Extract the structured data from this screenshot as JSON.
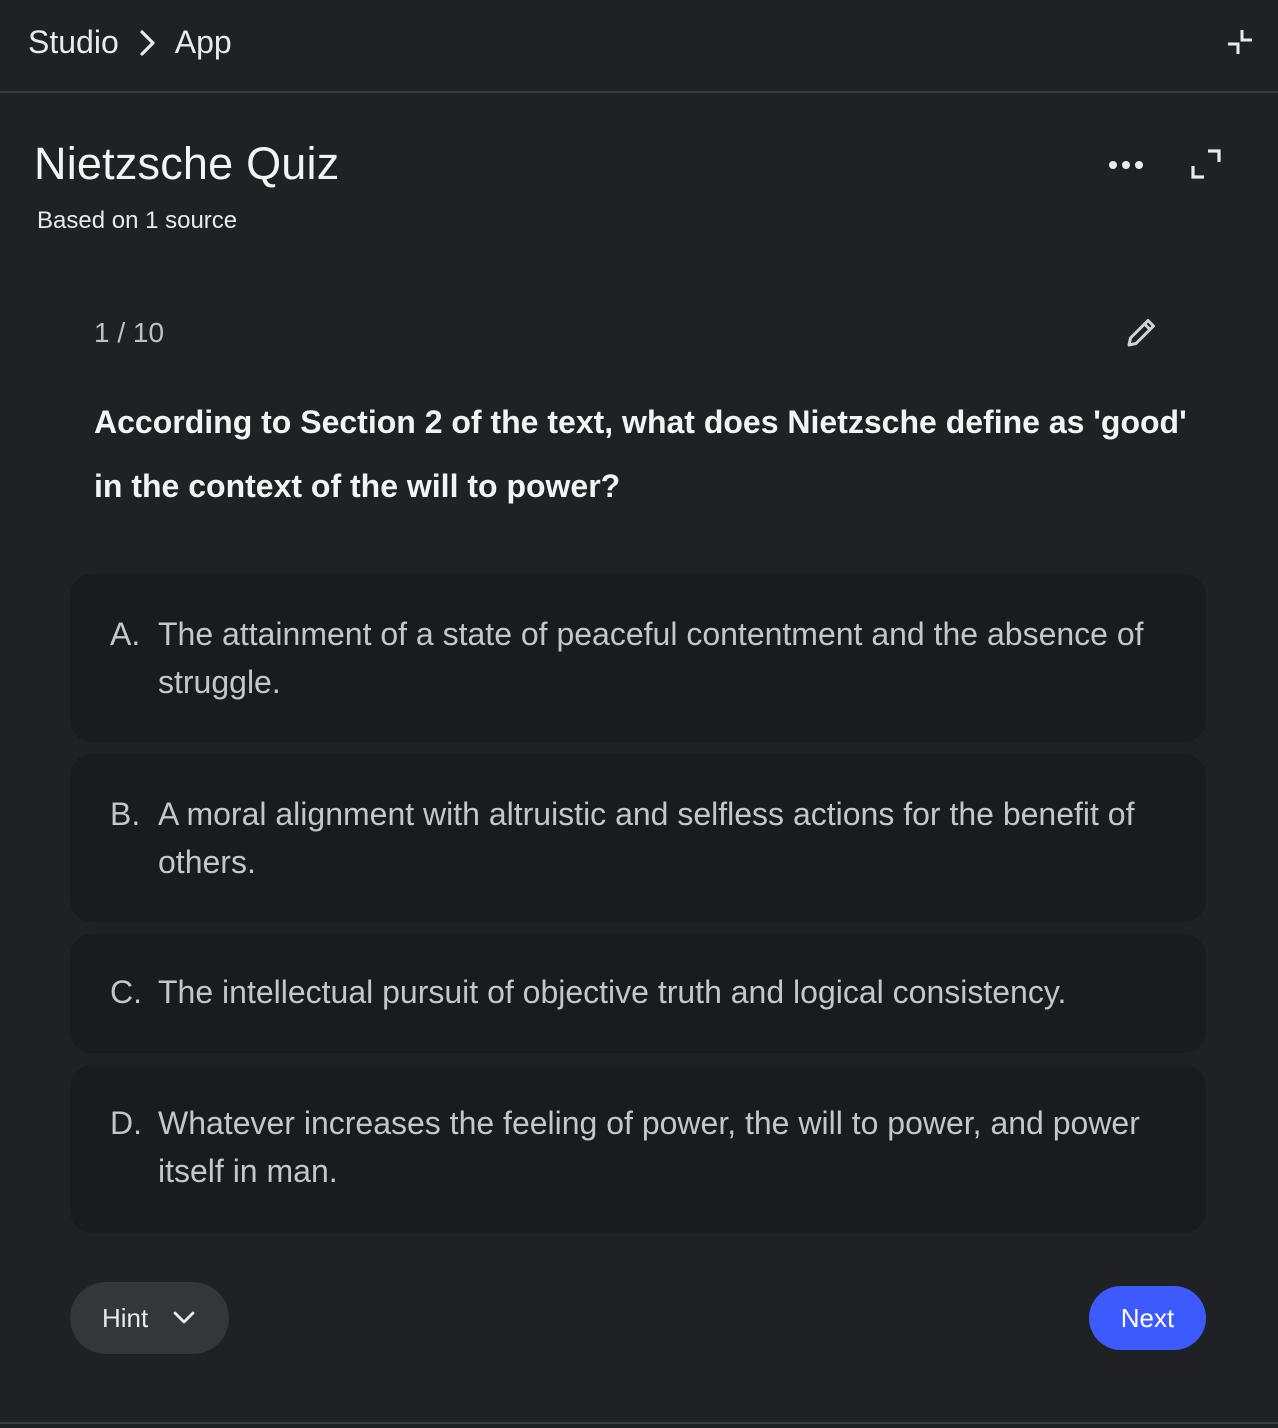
{
  "breadcrumb": {
    "root": "Studio",
    "current": "App"
  },
  "header": {
    "title": "Nietzsche Quiz",
    "subtitle": "Based on 1 source"
  },
  "quiz": {
    "counter": "1 / 10",
    "question": "According to Section 2 of the text, what does Nietzsche define as 'good' in the context of the will to power?",
    "options": [
      {
        "letter": "A.",
        "text": "The attainment of a state of peaceful contentment and the absence of struggle."
      },
      {
        "letter": "B.",
        "text": "A moral alignment with altruistic and selfless actions for the benefit of others."
      },
      {
        "letter": "C.",
        "text": "The intellectual pursuit of objective truth and logical consistency."
      },
      {
        "letter": "D.",
        "text": "Whatever increases the feeling of power, the will to power, and power itself in man."
      }
    ]
  },
  "actions": {
    "hint_label": "Hint",
    "next_label": "Next"
  },
  "icons": {
    "breadcrumb_separator": "chevron-right-icon",
    "collapse": "collapse-icon",
    "more": "more-horiz-icon",
    "expand": "expand-icon",
    "edit": "pencil-icon",
    "hint_toggle": "chevron-down-icon"
  },
  "colors": {
    "background": "#202124",
    "option_background": "#1a1b1e",
    "hint_background": "#35363a",
    "accent": "#3d5afe"
  }
}
